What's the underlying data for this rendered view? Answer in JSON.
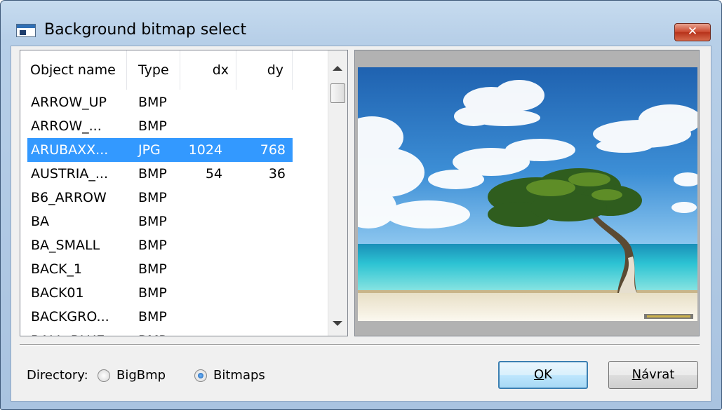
{
  "window": {
    "title": "Background bitmap select",
    "close_glyph": "✕"
  },
  "list": {
    "columns": [
      "Object name",
      "Type",
      "dx",
      "dy"
    ],
    "rows": [
      {
        "name": "ARROW_UP",
        "type": "BMP",
        "dx": "",
        "dy": ""
      },
      {
        "name": "ARROW_...",
        "type": "BMP",
        "dx": "",
        "dy": ""
      },
      {
        "name": "ARUBAXX...",
        "type": "JPG",
        "dx": "1024",
        "dy": "768",
        "selected": true
      },
      {
        "name": "AUSTRIA_...",
        "type": "BMP",
        "dx": "54",
        "dy": "36"
      },
      {
        "name": "B6_ARROW",
        "type": "BMP",
        "dx": "",
        "dy": ""
      },
      {
        "name": "BA",
        "type": "BMP",
        "dx": "",
        "dy": ""
      },
      {
        "name": "BA_SMALL",
        "type": "BMP",
        "dx": "",
        "dy": ""
      },
      {
        "name": "BACK_1",
        "type": "BMP",
        "dx": "",
        "dy": ""
      },
      {
        "name": "BACK01",
        "type": "BMP",
        "dx": "",
        "dy": ""
      },
      {
        "name": "BACKGRO...",
        "type": "BMP",
        "dx": "",
        "dy": ""
      },
      {
        "name": "BALL_BLUE",
        "type": "BMP",
        "dx": "",
        "dy": ""
      }
    ]
  },
  "directory": {
    "label": "Directory:",
    "options": [
      {
        "label": "BigBmp",
        "checked": false
      },
      {
        "label": "Bitmaps",
        "checked": true
      }
    ]
  },
  "buttons": {
    "ok_mnemonic": "O",
    "ok_rest": "K",
    "cancel_prefix": "",
    "cancel_mnemonic": "N",
    "cancel_rest": "ávrat"
  },
  "colors": {
    "selection": "#3399ff",
    "title_bar": "#b9d1ea",
    "close_button": "#c9452c"
  },
  "icons": {
    "app": "window-icon",
    "close": "close-icon",
    "scroll_up": "triangle-up-icon",
    "scroll_down": "triangle-down-icon"
  }
}
